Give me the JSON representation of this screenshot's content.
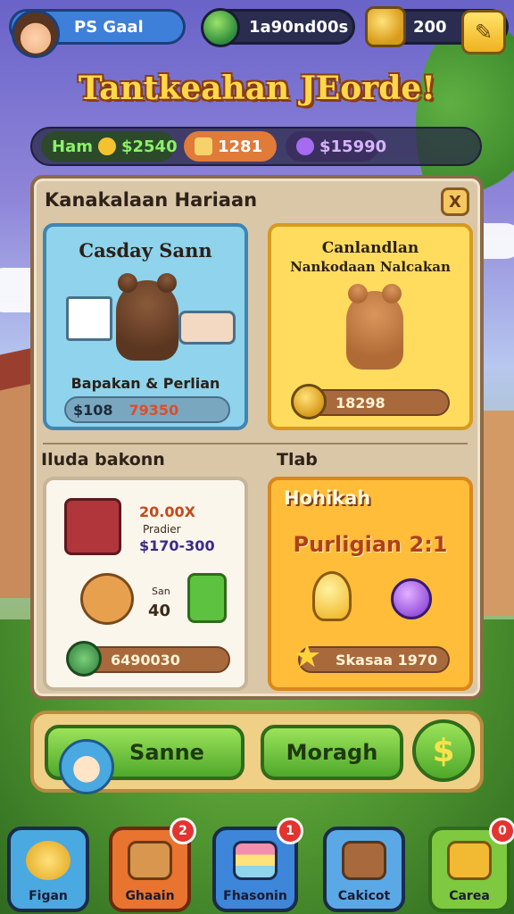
{
  "top_bar": {
    "player_name": "PS Gaal",
    "gems_value": "1a90nd00s",
    "coins_value": "200"
  },
  "title": "Tantkeahan JEorde!",
  "resources": [
    {
      "label": "Ham",
      "value": "$2540",
      "color": "#8cf06a"
    },
    {
      "label": "",
      "value": "1281",
      "color": "#ffffff"
    },
    {
      "label": "",
      "value": "$15990",
      "color": "#d8b4ff"
    }
  ],
  "panel": {
    "title": "Kanakalaan Hariaan",
    "close_label": "X",
    "section_left": "Iluda bakonn",
    "section_right": "Tlab",
    "cards": [
      {
        "title": "Casday Sann",
        "subtitle": "Bapakan & Perlian",
        "price_left": "$108",
        "price_right": "79350"
      },
      {
        "title": "Canlandlan",
        "subtitle": "Nankodaan Nalcakan",
        "price": "18298"
      },
      {
        "line1": "20.00X",
        "line2": "Pradier",
        "line3": "$170-300",
        "small_label": "San",
        "small_value": "40",
        "price": "6490030"
      },
      {
        "title": "Hohikah",
        "headline": "Purligian 2:1",
        "price": "Skasaa 1970"
      }
    ]
  },
  "actions": {
    "button1": "Sanne",
    "button2": "Moragh",
    "dollar_icon": "$"
  },
  "nav": [
    {
      "label": "Figan",
      "badge": ""
    },
    {
      "label": "Ghaain",
      "badge": "2"
    },
    {
      "label": "Fhasonin",
      "badge": "1"
    },
    {
      "label": "Cakicot",
      "badge": ""
    },
    {
      "label": "Carea",
      "badge": "0"
    }
  ]
}
